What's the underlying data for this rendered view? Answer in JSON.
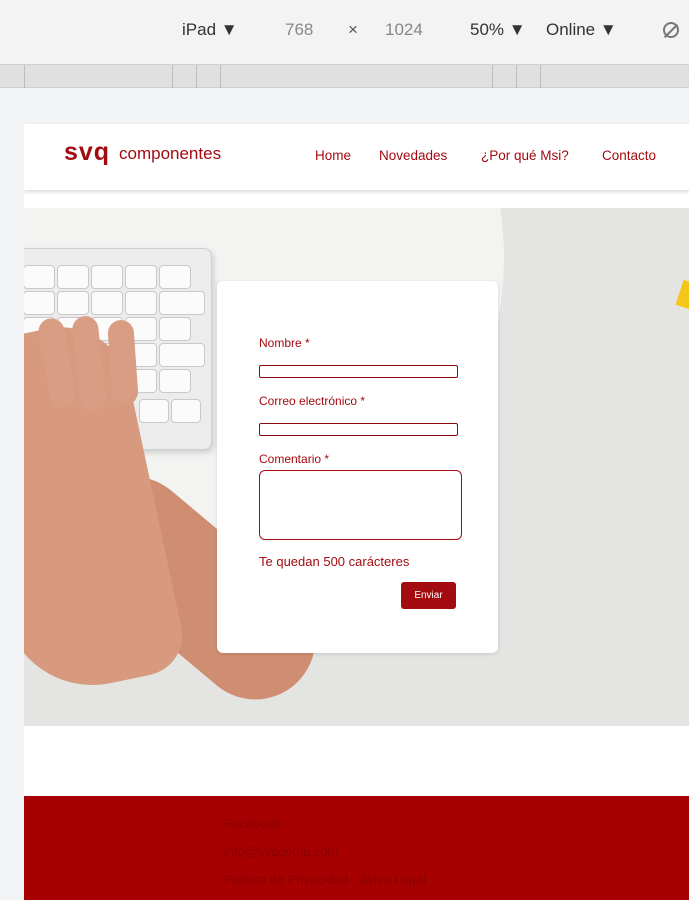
{
  "devtools": {
    "device": "iPad ▼",
    "width": "768",
    "times": "×",
    "height": "1024",
    "zoom": "50% ▼",
    "network": "Online ▼",
    "rotate_icon": "rotate-icon"
  },
  "site": {
    "logo_mark": "svq",
    "logo_text": "componentes",
    "nav": [
      "Home",
      "Novedades",
      "¿Por qué Msi?",
      "Contacto"
    ]
  },
  "form": {
    "name_label": "Nombre *",
    "email_label": "Correo electrónico *",
    "comment_label": "Comentario *",
    "chars_left": "Te quedan 500 carácteres",
    "submit_label": "Enviar"
  },
  "footer": {
    "links": [
      "Facebook",
      "info@svqcomp.com",
      "Politica de Privacidad · Aviso Legal"
    ]
  },
  "colors": {
    "brand": "#a30b10",
    "footer_bg": "#a60000"
  }
}
